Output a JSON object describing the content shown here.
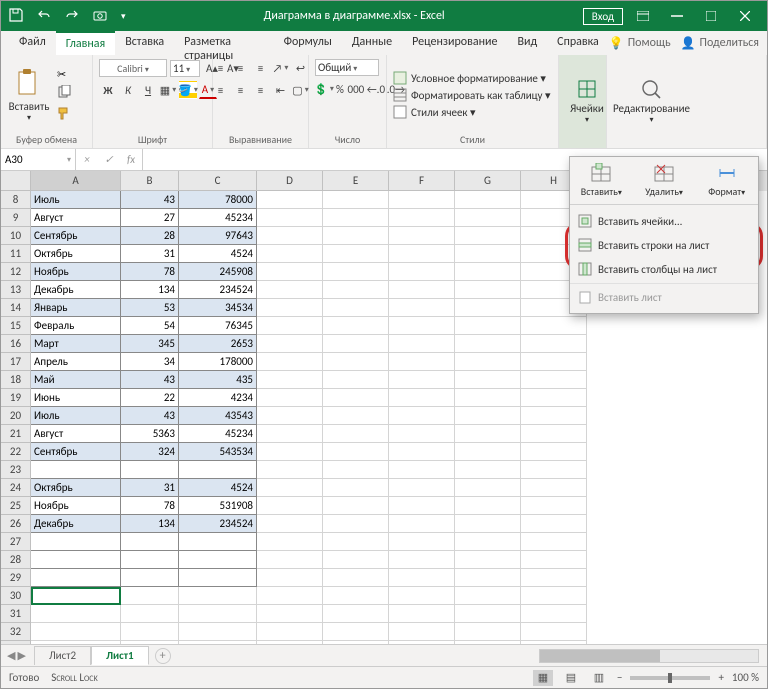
{
  "titlebar": {
    "title": "Диаграмма в диаграмме.xlsx - Excel",
    "login": "Вход"
  },
  "tabs": {
    "list": [
      "Файл",
      "Главная",
      "Вставка",
      "Разметка страницы",
      "Формулы",
      "Данные",
      "Рецензирование",
      "Вид",
      "Справка"
    ],
    "active": "Главная",
    "help": "Помощь",
    "share": "Поделиться"
  },
  "ribbon": {
    "clipboard": {
      "paste": "Вставить",
      "name": "Буфер обмена"
    },
    "font": {
      "family": "Calibri",
      "size": "11",
      "name": "Шрифт"
    },
    "align": {
      "name": "Выравнивание"
    },
    "number": {
      "format": "Общий",
      "name": "Число"
    },
    "styles": {
      "cond": "Условное форматирование ▾",
      "table": "Форматировать как таблицу ▾",
      "cell": "Стили ячеек ▾",
      "name": "Стили"
    },
    "cells": {
      "label": "Ячейки",
      "name": "Ячейки"
    },
    "editing": {
      "label": "Редактирование"
    }
  },
  "namebox": "A30",
  "columns": [
    "A",
    "B",
    "C",
    "D",
    "E",
    "F",
    "G",
    "H"
  ],
  "startRow": 8,
  "data": [
    [
      "Июль",
      "43",
      "78000"
    ],
    [
      "Август",
      "27",
      "45234"
    ],
    [
      "Сентябрь",
      "28",
      "97643"
    ],
    [
      "Октябрь",
      "31",
      "4524"
    ],
    [
      "Ноябрь",
      "78",
      "245908"
    ],
    [
      "Декабрь",
      "134",
      "234524"
    ],
    [
      "Январь",
      "53",
      "34534"
    ],
    [
      "Февраль",
      "54",
      "76345"
    ],
    [
      "Март",
      "345",
      "2653"
    ],
    [
      "Апрель",
      "34",
      "178000"
    ],
    [
      "Май",
      "43",
      "435"
    ],
    [
      "Июнь",
      "22",
      "4234"
    ],
    [
      "Июль",
      "43",
      "43543"
    ],
    [
      "Август",
      "5363",
      "45234"
    ],
    [
      "Сентябрь",
      "324",
      "543534"
    ],
    [
      "",
      "",
      ""
    ],
    [
      "Октябрь",
      "31",
      "4524"
    ],
    [
      "Ноябрь",
      "78",
      "531908"
    ],
    [
      "Декабрь",
      "134",
      "234524"
    ]
  ],
  "shadeRows": [
    8,
    10,
    12,
    14,
    16,
    18,
    20,
    22,
    24,
    26
  ],
  "activeRow": 30,
  "sheets": {
    "list": [
      "Лист2",
      "Лист1"
    ],
    "active": "Лист1"
  },
  "status": {
    "ready": "Готово",
    "scroll": "Scroll Lock",
    "zoom": "100 %"
  },
  "popup": {
    "head": {
      "insert": "Вставить",
      "delete": "Удалить",
      "format": "Формат"
    },
    "items": {
      "cells": "Вставить ячейки...",
      "rows": "Вставить строки на лист",
      "cols": "Вставить столбцы на лист",
      "sheet": "Вставить лист"
    }
  }
}
